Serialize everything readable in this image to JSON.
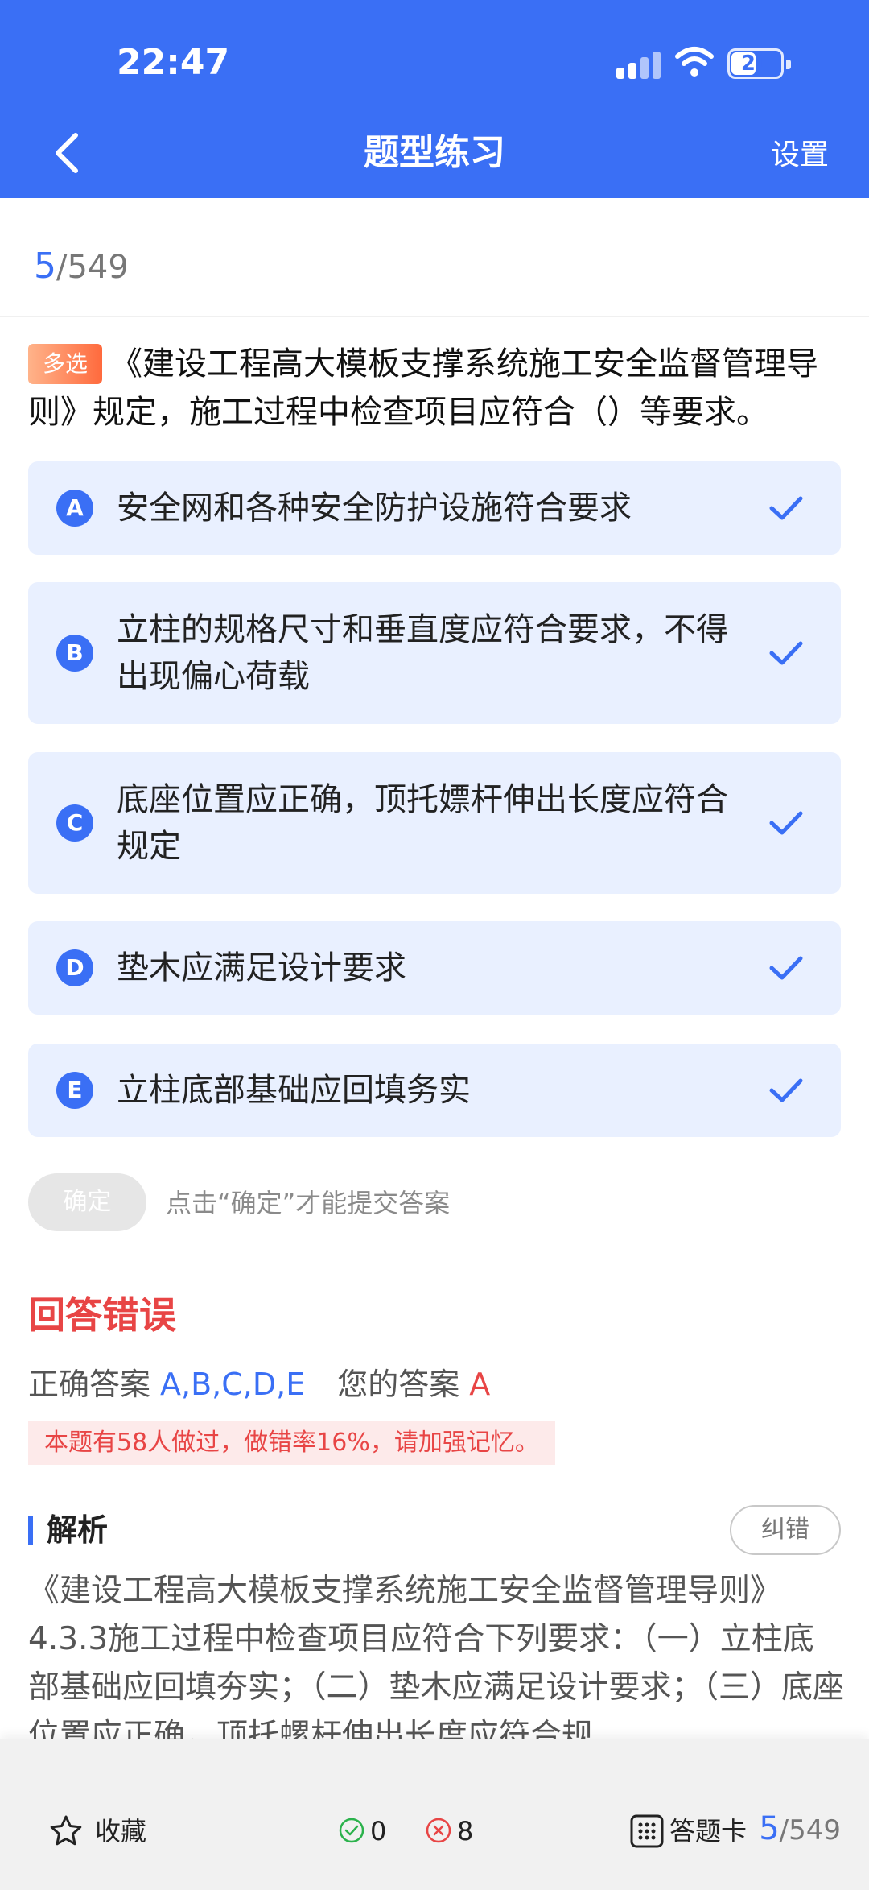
{
  "status_bar": {
    "time": "22:47",
    "battery": "21"
  },
  "header": {
    "title": "题型练习",
    "settings_label": "设置"
  },
  "progress": {
    "current": "5",
    "total": "/549"
  },
  "question": {
    "tag": "多选",
    "text": "《建设工程高大模板支撑系统施工安全监督管理导则》规定，施工过程中检查项目应符合（）等要求。"
  },
  "options": [
    {
      "letter": "A",
      "text": "安全网和各种安全防护设施符合要求",
      "checked": true
    },
    {
      "letter": "B",
      "text": "立柱的规格尺寸和垂直度应符合要求，不得出现偏心荷载",
      "checked": true
    },
    {
      "letter": "C",
      "text": "底座位置应正确，顶托嫖杆伸出长度应符合规定",
      "checked": true
    },
    {
      "letter": "D",
      "text": "垫木应满足设计要求",
      "checked": true
    },
    {
      "letter": "E",
      "text": "立柱底部基础应回填务实",
      "checked": true
    }
  ],
  "confirm": {
    "label": "确定",
    "hint": "点击“确定”才能提交答案"
  },
  "result": {
    "title": "回答错误",
    "correct_label": "正确答案",
    "correct_value": "A,B,C,D,E",
    "your_label": "您的答案",
    "your_value": "A",
    "stat": "本题有58人做过，做错率16%，请加强记忆。"
  },
  "analysis": {
    "title": "解析",
    "report_label": "纠错",
    "text": "《建设工程高大模板支撑系统施工安全监督管理导则》4.3.3施工过程中检查项目应符合下列要求：（一）立柱底部基础应回填夯实；（二）垫木应满足设计要求；（三）底座位置应正确，顶托螺杆伸出长度应符合规"
  },
  "bottom_bar": {
    "favorite_label": "收藏",
    "correct_count": "0",
    "wrong_count": "8",
    "answer_card_label": "答题卡",
    "progress_current": "5",
    "progress_total": "/549"
  },
  "colors": {
    "primary": "#3a6ff5",
    "error": "#e84545",
    "option_bg": "#e9f0ff"
  }
}
